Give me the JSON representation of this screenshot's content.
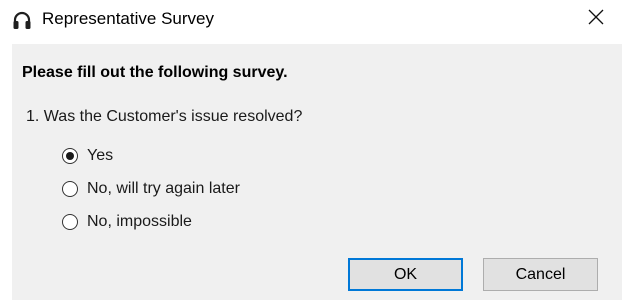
{
  "window": {
    "title": "Representative Survey",
    "icon": "headset-icon"
  },
  "form": {
    "heading": "Please fill out the following survey.",
    "question": "1. Was the Customer's issue resolved?",
    "options": [
      {
        "label": "Yes",
        "selected": true
      },
      {
        "label": "No, will try again later",
        "selected": false
      },
      {
        "label": "No, impossible",
        "selected": false
      }
    ]
  },
  "buttons": {
    "ok": "OK",
    "cancel": "Cancel"
  },
  "colors": {
    "panel": "#f0f0f0",
    "button": "#e1e1e1",
    "default_border": "#0078d7"
  }
}
